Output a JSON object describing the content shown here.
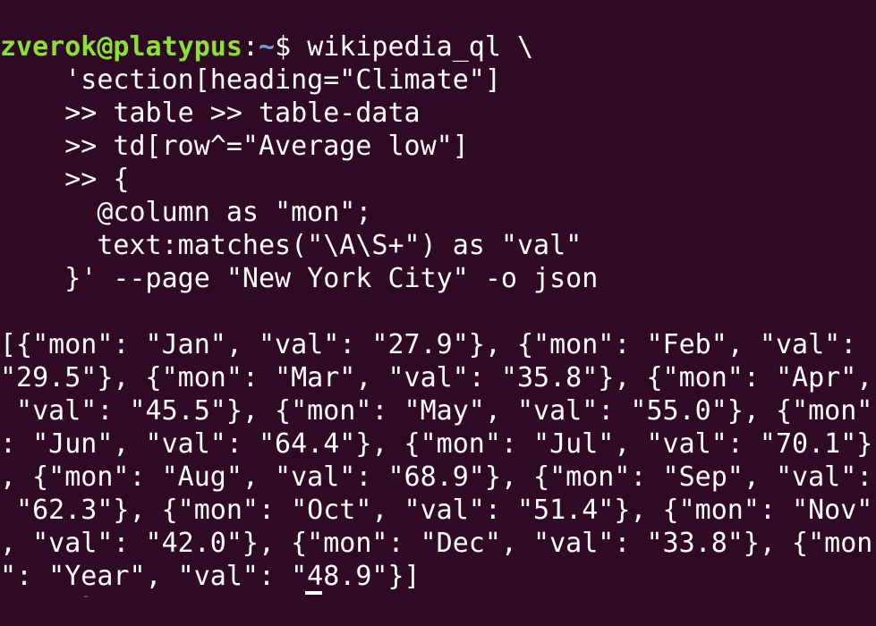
{
  "terminal": {
    "prompt": {
      "user_host": "zverok@platypus",
      "separator": ":",
      "path": "~",
      "symbol": "$ ",
      "command": "wikipedia_ql \\"
    },
    "command_lines": [
      "    'section[heading=\"Climate\"]",
      "    >> table >> table-data",
      "    >> td[row^=\"Average low\"]",
      "    >> {",
      "      @column as \"mon\";",
      "      text:matches(\"\\A\\S+\") as \"val\"",
      "    }' --page \"New York City\" -o json"
    ],
    "output_lines": [
      "[{\"mon\": \"Jan\", \"val\": \"27.9\"}, {\"mon\": \"Feb\", \"val\":",
      "\"29.5\"}, {\"mon\": \"Mar\", \"val\": \"35.8\"}, {\"mon\": \"Apr\",",
      " \"val\": \"45.5\"}, {\"mon\": \"May\", \"val\": \"55.0\"}, {\"mon\"",
      ": \"Jun\", \"val\": \"64.4\"}, {\"mon\": \"Jul\", \"val\": \"70.1\"}",
      ", {\"mon\": \"Aug\", \"val\": \"68.9\"}, {\"mon\": \"Sep\", \"val\":",
      " \"62.3\"}, {\"mon\": \"Oct\", \"val\": \"51.4\"}, {\"mon\": \"Nov\"",
      ", \"val\": \"42.0\"}, {\"mon\": \"Dec\", \"val\": \"33.8\"}, {\"mon",
      "\": \"Year\", \"val\": \"48.9\"}]"
    ],
    "colors": {
      "background": "#300a24",
      "foreground": "#ffffff",
      "user_host": "#8ae234",
      "path": "#729fcf"
    }
  }
}
